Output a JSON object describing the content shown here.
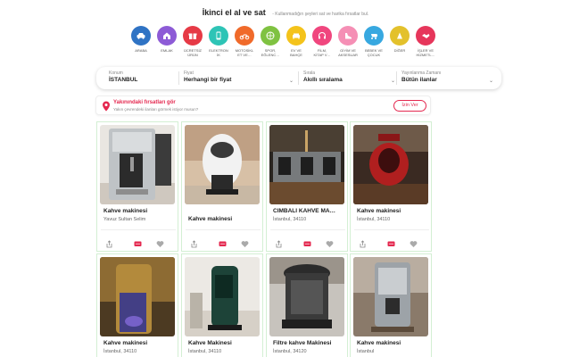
{
  "header": {
    "title": "İkinci el al ve sat",
    "subtitle": "- Kullanmadığın şeyleri sat ve harika fırsatlar bul."
  },
  "categories": [
    {
      "label": "ARABA",
      "icon": "car-icon",
      "color": "#2f73c4"
    },
    {
      "label": "EMLAK",
      "icon": "house-icon",
      "color": "#8d5bd6"
    },
    {
      "label": "ÜCRETSİZ\nÜRÜN",
      "icon": "gift-icon",
      "color": "#e63a46"
    },
    {
      "label": "ELEKTRON\nİK",
      "icon": "phone-icon",
      "color": "#2ec4b6"
    },
    {
      "label": "MOTOSİKL\nET VE…",
      "icon": "motorcycle-icon",
      "color": "#f06a2a"
    },
    {
      "label": "SPOR,\nEĞLENC…",
      "icon": "ball-icon",
      "color": "#7fc241"
    },
    {
      "label": "EV VE\nBAHÇE",
      "icon": "sofa-icon",
      "color": "#f4c31b"
    },
    {
      "label": "FİLM,\nKİTAP V…",
      "icon": "headphones-icon",
      "color": "#f0467e"
    },
    {
      "label": "GİYİM VE\nAKSESUAR",
      "icon": "shoe-icon",
      "color": "#f58fb5"
    },
    {
      "label": "BEBEK VE\nÇOCUK",
      "icon": "stroller-icon",
      "color": "#37a8e0"
    },
    {
      "label": "DİĞER",
      "icon": "grid-icon",
      "color": "#e3c12c"
    },
    {
      "label": "İŞLER VE\nHİZMETL…",
      "icon": "handshake-icon",
      "color": "#e6365b"
    }
  ],
  "filters": [
    {
      "label": "Konum",
      "value": "İSTANBUL"
    },
    {
      "label": "Fiyat",
      "value": "Herhangi bir fiyat"
    },
    {
      "label": "Sırala",
      "value": "Akıllı sıralama"
    },
    {
      "label": "Yayınlanma Zamanı",
      "value": "Bütün ilanlar"
    }
  ],
  "banner": {
    "title": "Yakınındaki fırsatları gör",
    "text": "Yakın çevrendeki ilanları görmek istiyor musun?",
    "button": "İzin Ver"
  },
  "listings": [
    {
      "title": "Kahve makinesi",
      "location": "Yavuz Sultan Selim",
      "image": "espresso-machine"
    },
    {
      "title": "Kahve makinesi",
      "location": "",
      "image": "capsule-machine"
    },
    {
      "title": "CIMBALI KAHVE MA…",
      "location": "İstanbul, 34110",
      "image": "cafe-counter"
    },
    {
      "title": "Kahve makinesi",
      "location": "İstanbul, 34110",
      "image": "red-kettle"
    },
    {
      "title": "Kahve makinesi",
      "location": "İstanbul, 34110",
      "image": "glass-machine"
    },
    {
      "title": "Kahve Makinesi",
      "location": "İstanbul, 34110",
      "image": "pod-machine"
    },
    {
      "title": "Filtre kahve Makinesi",
      "location": "İstanbul, 34120",
      "image": "filter-machine"
    },
    {
      "title": "Kahve makinesi",
      "location": "İstanbul",
      "image": "steel-machine"
    }
  ]
}
